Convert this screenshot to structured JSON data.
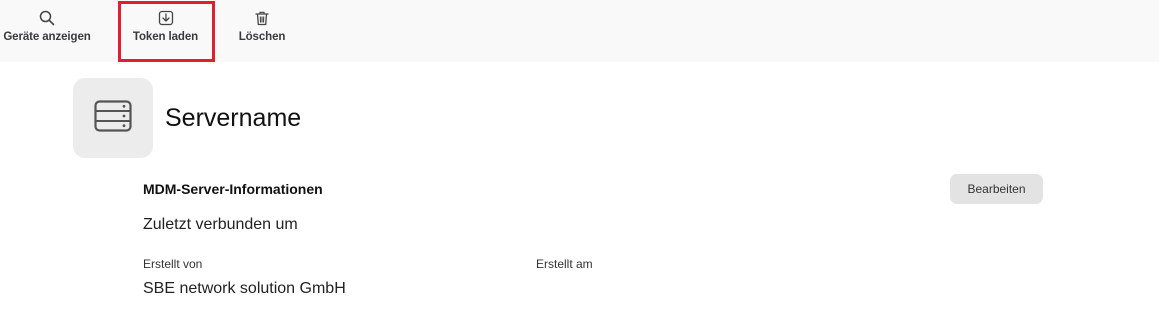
{
  "toolbar": {
    "show_devices_label": "Geräte anzeigen",
    "show_devices_icon": "search-icon",
    "load_token_label": "Token laden",
    "load_token_icon": "download-icon",
    "delete_label": "Löschen",
    "delete_icon": "trash-icon",
    "highlight_color": "#e0202a"
  },
  "server": {
    "icon": "server-icon",
    "name": "Servername"
  },
  "info": {
    "section_title": "MDM-Server-Informationen",
    "edit_label": "Bearbeiten",
    "last_connected_label": "Zuletzt verbunden um",
    "created_by_label": "Erstellt von",
    "created_by_value": "SBE network solution GmbH",
    "created_at_label": "Erstellt am"
  }
}
